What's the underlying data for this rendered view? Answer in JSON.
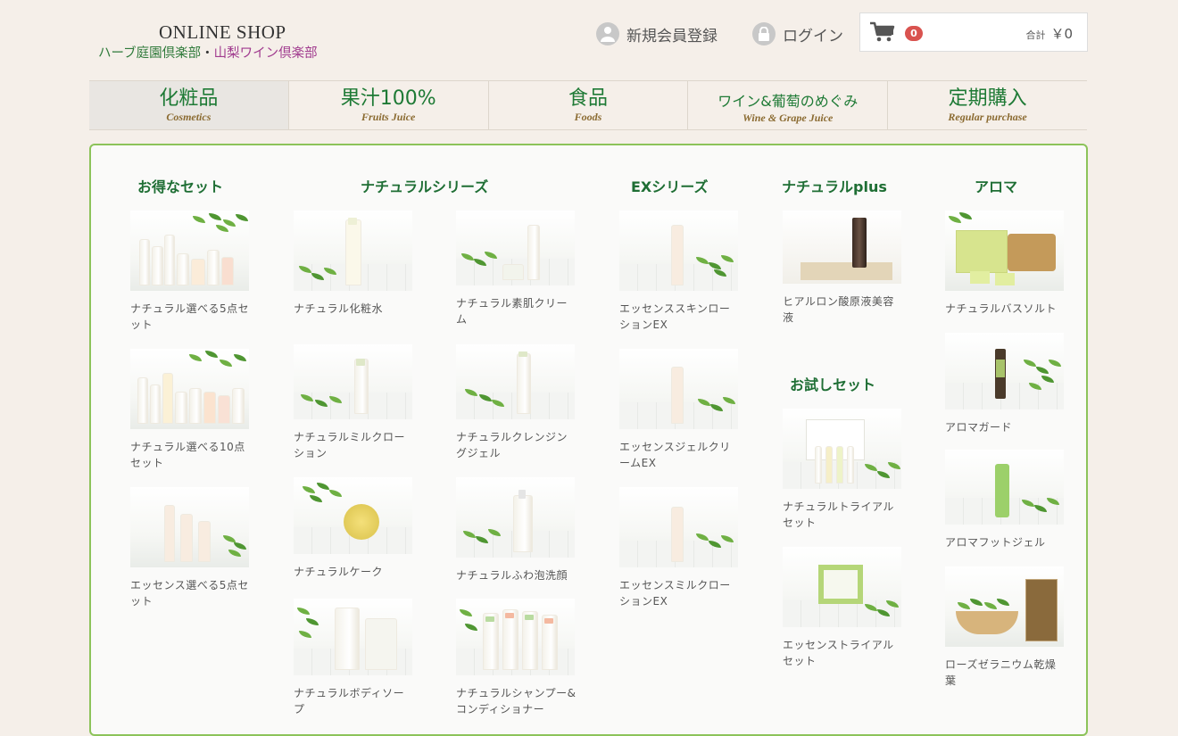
{
  "header": {
    "shop_title": "ONLINE SHOP",
    "club_herb": "ハーブ庭園倶楽部",
    "club_sep": "・",
    "club_wine": "山梨ワイン倶楽部",
    "register_label": "新規会員登録",
    "login_label": "ログイン",
    "cart": {
      "count": "0",
      "total_label": "合計",
      "total_value": "￥0"
    }
  },
  "nav": [
    {
      "jp": "化粧品",
      "en": "Cosmetics",
      "active": true
    },
    {
      "jp": "果汁100%",
      "en": "Fruits Juice"
    },
    {
      "jp": "食品",
      "en": "Foods"
    },
    {
      "jp": "ワイン&葡萄のめぐみ",
      "en": "Wine & Grape Juice"
    },
    {
      "jp": "定期購入",
      "en": "Regular purchase"
    }
  ],
  "columns": {
    "sets": {
      "title": "お得なセット",
      "items": [
        "ナチュラル選べる5点セット",
        "ナチュラル選べる10点セット",
        "エッセンス選べる5点セット"
      ]
    },
    "natural": {
      "title": "ナチュラルシリーズ",
      "items": [
        "ナチュラル化粧水",
        "ナチュラル素肌クリーム",
        "ナチュラルミルクローション",
        "ナチュラルクレンジングジェル",
        "ナチュラルケーク",
        "ナチュラルふわ泡洗顔",
        "ナチュラルボディソープ",
        "ナチュラルシャンプー&コンディショナー"
      ]
    },
    "ex": {
      "title": "EXシリーズ",
      "items": [
        "エッセンススキンローションEX",
        "エッセンスジェルクリームEX",
        "エッセンスミルクローションEX"
      ]
    },
    "plus": {
      "title": "ナチュラルplus",
      "items": [
        "ヒアルロン酸原液美容液"
      ]
    },
    "trial": {
      "title": "お試しセット",
      "items": [
        "ナチュラルトライアルセット",
        "エッセンストライアルセット"
      ]
    },
    "aroma": {
      "title": "アロマ",
      "items": [
        "ナチュラルバスソルト",
        "アロマガード",
        "アロマフットジェル",
        "ローズゼラニウム乾燥葉"
      ]
    }
  },
  "colors": {
    "accent_green": "#1e7a35",
    "panel_border": "#8cc35a",
    "badge_red": "#d9534f"
  }
}
